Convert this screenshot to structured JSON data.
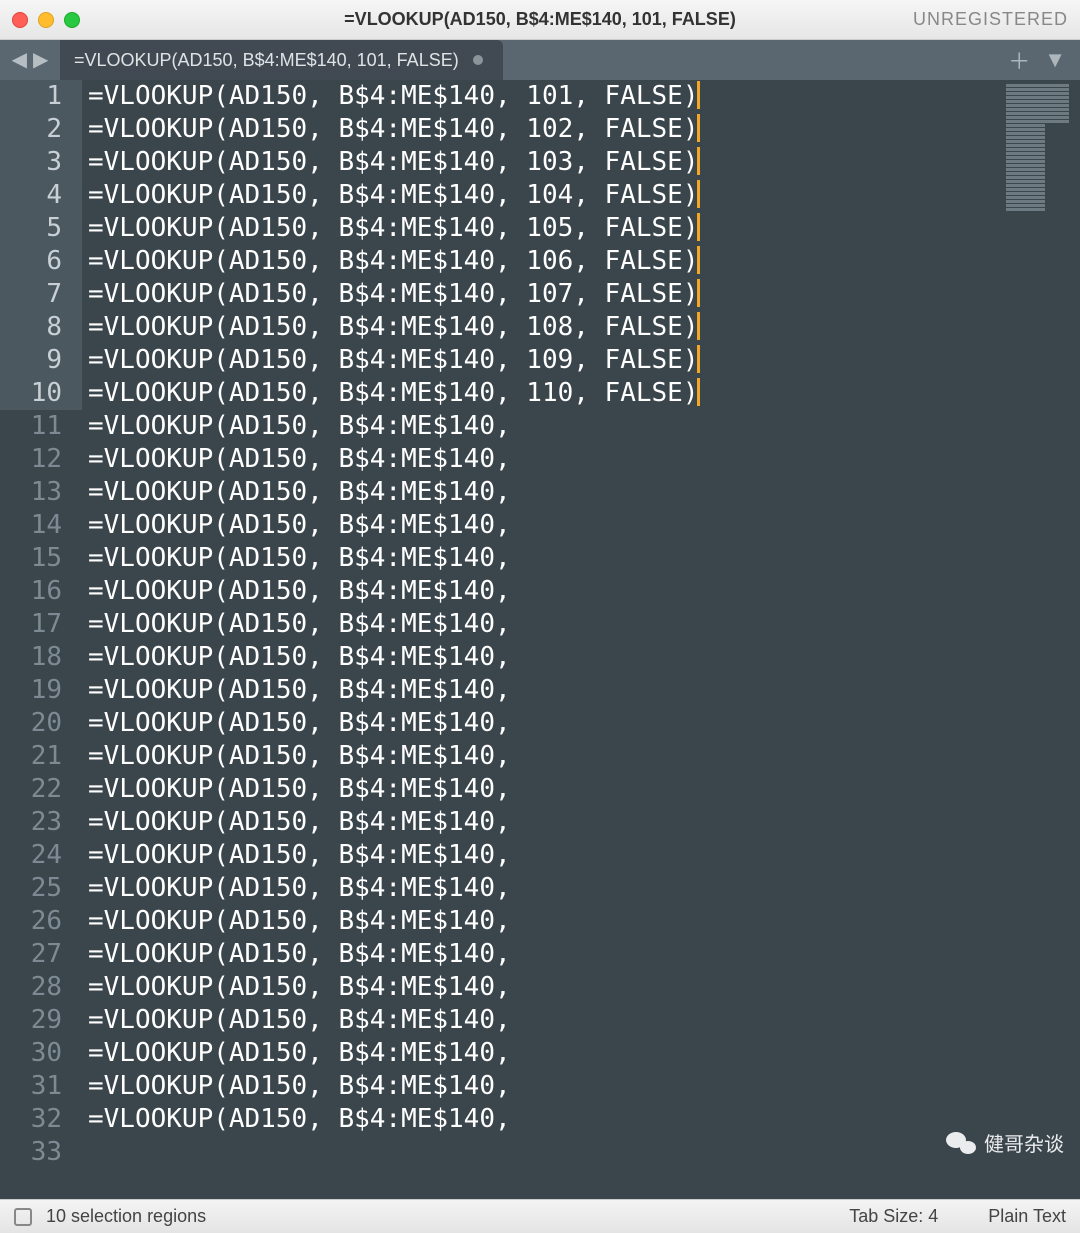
{
  "titlebar": {
    "title": "=VLOOKUP(AD150, B$4:ME$140, 101, FALSE)",
    "right": "UNREGISTERED"
  },
  "tab": {
    "label": "=VLOOKUP(AD150, B$4:ME$140, 101, FALSE)"
  },
  "editor": {
    "lines": [
      {
        "num": 1,
        "text": "=VLOOKUP(AD150, B$4:ME$140, 101, FALSE)",
        "cursor": true,
        "selected": true
      },
      {
        "num": 2,
        "text": "=VLOOKUP(AD150, B$4:ME$140, 102, FALSE)",
        "cursor": true,
        "selected": true
      },
      {
        "num": 3,
        "text": "=VLOOKUP(AD150, B$4:ME$140, 103, FALSE)",
        "cursor": true,
        "selected": true
      },
      {
        "num": 4,
        "text": "=VLOOKUP(AD150, B$4:ME$140, 104, FALSE)",
        "cursor": true,
        "selected": true
      },
      {
        "num": 5,
        "text": "=VLOOKUP(AD150, B$4:ME$140, 105, FALSE)",
        "cursor": true,
        "selected": true
      },
      {
        "num": 6,
        "text": "=VLOOKUP(AD150, B$4:ME$140, 106, FALSE)",
        "cursor": true,
        "selected": true
      },
      {
        "num": 7,
        "text": "=VLOOKUP(AD150, B$4:ME$140, 107, FALSE)",
        "cursor": true,
        "selected": true
      },
      {
        "num": 8,
        "text": "=VLOOKUP(AD150, B$4:ME$140, 108, FALSE)",
        "cursor": true,
        "selected": true
      },
      {
        "num": 9,
        "text": "=VLOOKUP(AD150, B$4:ME$140, 109, FALSE)",
        "cursor": true,
        "selected": true
      },
      {
        "num": 10,
        "text": "=VLOOKUP(AD150, B$4:ME$140, 110, FALSE)",
        "cursor": true,
        "selected": true
      },
      {
        "num": 11,
        "text": "=VLOOKUP(AD150, B$4:ME$140,",
        "cursor": false,
        "selected": false
      },
      {
        "num": 12,
        "text": "=VLOOKUP(AD150, B$4:ME$140,",
        "cursor": false,
        "selected": false
      },
      {
        "num": 13,
        "text": "=VLOOKUP(AD150, B$4:ME$140,",
        "cursor": false,
        "selected": false
      },
      {
        "num": 14,
        "text": "=VLOOKUP(AD150, B$4:ME$140,",
        "cursor": false,
        "selected": false
      },
      {
        "num": 15,
        "text": "=VLOOKUP(AD150, B$4:ME$140,",
        "cursor": false,
        "selected": false
      },
      {
        "num": 16,
        "text": "=VLOOKUP(AD150, B$4:ME$140,",
        "cursor": false,
        "selected": false
      },
      {
        "num": 17,
        "text": "=VLOOKUP(AD150, B$4:ME$140,",
        "cursor": false,
        "selected": false
      },
      {
        "num": 18,
        "text": "=VLOOKUP(AD150, B$4:ME$140,",
        "cursor": false,
        "selected": false
      },
      {
        "num": 19,
        "text": "=VLOOKUP(AD150, B$4:ME$140,",
        "cursor": false,
        "selected": false
      },
      {
        "num": 20,
        "text": "=VLOOKUP(AD150, B$4:ME$140,",
        "cursor": false,
        "selected": false
      },
      {
        "num": 21,
        "text": "=VLOOKUP(AD150, B$4:ME$140,",
        "cursor": false,
        "selected": false
      },
      {
        "num": 22,
        "text": "=VLOOKUP(AD150, B$4:ME$140,",
        "cursor": false,
        "selected": false
      },
      {
        "num": 23,
        "text": "=VLOOKUP(AD150, B$4:ME$140,",
        "cursor": false,
        "selected": false
      },
      {
        "num": 24,
        "text": "=VLOOKUP(AD150, B$4:ME$140,",
        "cursor": false,
        "selected": false
      },
      {
        "num": 25,
        "text": "=VLOOKUP(AD150, B$4:ME$140,",
        "cursor": false,
        "selected": false
      },
      {
        "num": 26,
        "text": "=VLOOKUP(AD150, B$4:ME$140,",
        "cursor": false,
        "selected": false
      },
      {
        "num": 27,
        "text": "=VLOOKUP(AD150, B$4:ME$140,",
        "cursor": false,
        "selected": false
      },
      {
        "num": 28,
        "text": "=VLOOKUP(AD150, B$4:ME$140,",
        "cursor": false,
        "selected": false
      },
      {
        "num": 29,
        "text": "=VLOOKUP(AD150, B$4:ME$140,",
        "cursor": false,
        "selected": false
      },
      {
        "num": 30,
        "text": "=VLOOKUP(AD150, B$4:ME$140,",
        "cursor": false,
        "selected": false
      },
      {
        "num": 31,
        "text": "=VLOOKUP(AD150, B$4:ME$140,",
        "cursor": false,
        "selected": false
      },
      {
        "num": 32,
        "text": "=VLOOKUP(AD150, B$4:ME$140,",
        "cursor": false,
        "selected": false
      },
      {
        "num": 33,
        "text": "",
        "cursor": false,
        "selected": false
      }
    ]
  },
  "statusbar": {
    "left": "10 selection regions",
    "tabsize": "Tab Size: 4",
    "syntax": "Plain Text"
  },
  "watermark": {
    "text": "健哥杂谈"
  }
}
